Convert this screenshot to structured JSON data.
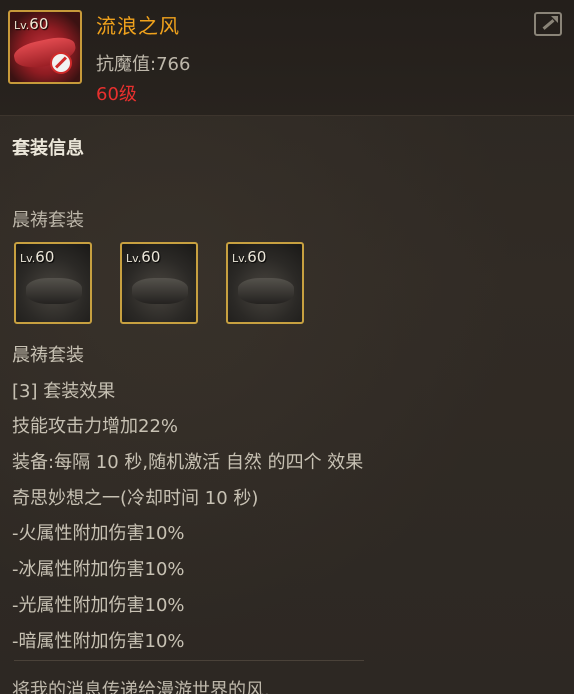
{
  "item": {
    "name": "流浪之风",
    "level_badge_prefix": "Lv.",
    "level_badge_value": "60",
    "stat": "抗魔值:766",
    "level_text": "60级",
    "icon": "red-belt-icon",
    "restriction_icon": "no-trade-icon"
  },
  "header": {
    "share_icon": "share-icon"
  },
  "set_info": {
    "section_title": "套装信息",
    "set_name": "晨祷套装",
    "pieces": [
      {
        "lv_prefix": "Lv.",
        "lv_value": "60",
        "icon": "necklace-icon"
      },
      {
        "lv_prefix": "Lv.",
        "lv_value": "60",
        "icon": "bracelet-icon"
      },
      {
        "lv_prefix": "Lv.",
        "lv_value": "60",
        "icon": "ring-icon"
      }
    ],
    "lines": [
      "晨祷套装",
      "[3] 套装效果",
      "技能攻击力增加22%",
      "装备:每隔 10 秒,随机激活 自然 的四个 效果",
      "奇思妙想之一(冷却时间 10 秒)",
      "-火属性附加伤害10%",
      "-冰属性附加伤害10%",
      "-光属性附加伤害10%",
      "-暗属性附加伤害10%"
    ]
  },
  "flavor_text": "将我的消息传递给漫游世界的风.",
  "colors": {
    "item_name": "#f0a21c",
    "level_red": "#e8302e",
    "frame_gold": "#c7a040",
    "background": "#2d2823"
  }
}
